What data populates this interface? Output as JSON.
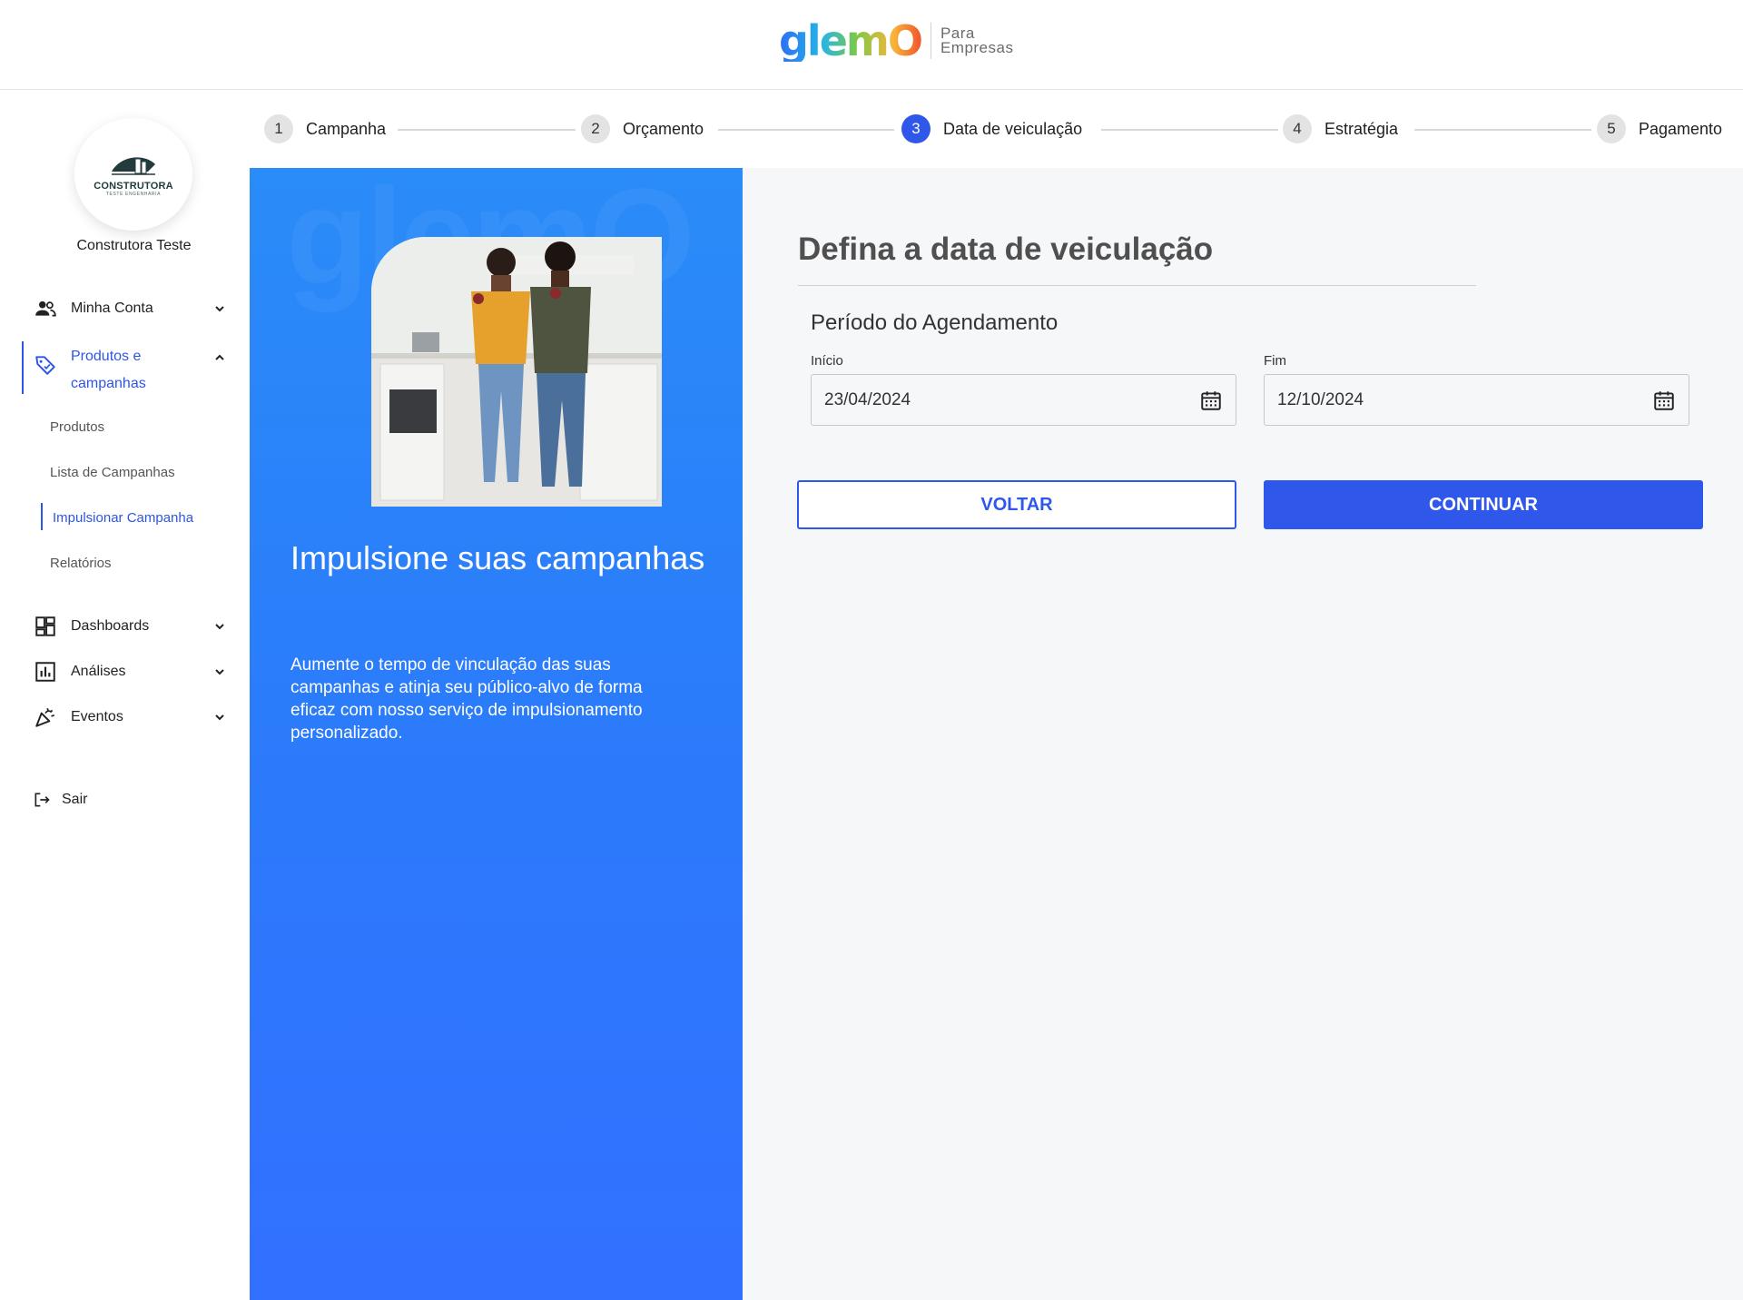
{
  "header": {
    "logo_text": "glemO",
    "logo_sub_line1": "Para",
    "logo_sub_line2": "Empresas"
  },
  "sidebar": {
    "company_logo_title": "CONSTRUTORA",
    "company_logo_small": "TESTE ENGENHARIA",
    "company_name": "Construtora Teste",
    "nav": {
      "minha_conta": "Minha Conta",
      "produtos_line1": "Produtos e",
      "produtos_line2": "campanhas",
      "dashboards": "Dashboards",
      "analises": "Análises",
      "eventos": "Eventos",
      "sair": "Sair"
    },
    "sub": {
      "produtos": "Produtos",
      "lista": "Lista de Campanhas",
      "impulsionar": "Impulsionar Campanha",
      "relatorios": "Relatórios"
    }
  },
  "stepper": {
    "steps": [
      {
        "num": "1",
        "label": "Campanha"
      },
      {
        "num": "2",
        "label": "Orçamento"
      },
      {
        "num": "3",
        "label": "Data de veiculação"
      },
      {
        "num": "4",
        "label": "Estratégia"
      },
      {
        "num": "5",
        "label": "Pagamento"
      }
    ],
    "current": 3
  },
  "promo": {
    "bg_text": "glemO",
    "title": "Impulsione suas campanhas",
    "text": "Aumente o tempo de vinculação das suas campanhas e atinja seu público-alvo de forma eficaz com nosso serviço de impulsionamento personalizado."
  },
  "form": {
    "title": "Defina a data de veiculação",
    "section": "Período do Agendamento",
    "start_label": "Início",
    "start_value": "23/04/2024",
    "end_label": "Fim",
    "end_value": "12/10/2024",
    "back_label": "VOLTAR",
    "continue_label": "CONTINUAR"
  },
  "colors": {
    "accent": "#2f58ea",
    "promo_gradient_top": "#2a8cf8",
    "promo_gradient_bottom": "#3270ff",
    "form_bg": "#f6f7f9"
  }
}
